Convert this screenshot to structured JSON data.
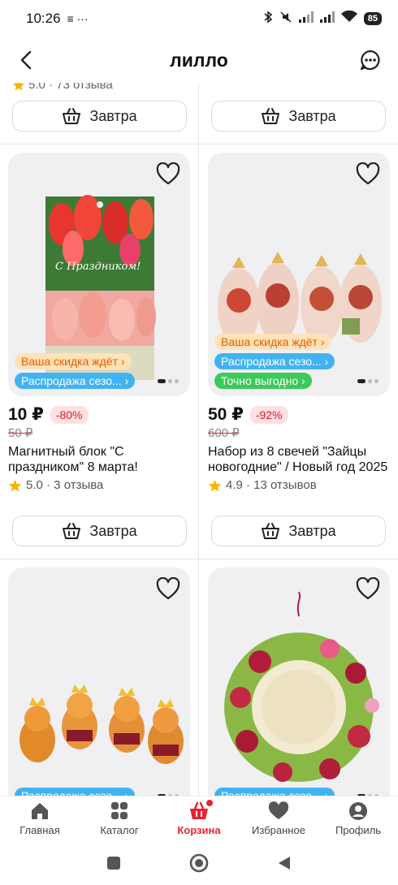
{
  "status": {
    "time": "10:26",
    "battery": "85"
  },
  "header": {
    "title": "лилло"
  },
  "partial_top": {
    "rating": "5.0 · 73 отзыва",
    "cart_left": "Завтра",
    "cart_right": "Завтра"
  },
  "products": [
    {
      "price": "10 ₽",
      "discount": "-80%",
      "old_price": "50 ₽",
      "title": "Магнитный блок \"С праздником\" 8 марта!",
      "rating": "5.0 · 3 отзыва",
      "badges": [
        "Ваша скидка ждёт ›",
        "Распродажа сезо... ›"
      ],
      "cart": "Завтра",
      "img_text": "С Праздником!"
    },
    {
      "price": "50 ₽",
      "discount": "-92%",
      "old_price": "600 ₽",
      "title": "Набор из 8 свечей \"Зайцы новогодние\" / Новый год 2025",
      "rating": "4.9 · 13 отзывов",
      "badges": [
        "Ваша скидка ждёт ›",
        "Распродажа сезо... ›",
        "Точно выгодно ›"
      ],
      "cart": "Завтра"
    },
    {
      "badges": [
        "Распродажа сезо... ›"
      ]
    },
    {
      "badges": [
        "Распродажа сезо... ›"
      ]
    }
  ],
  "nav": {
    "home": "Главная",
    "catalog": "Каталог",
    "cart": "Корзина",
    "favorites": "Избранное",
    "profile": "Профиль"
  },
  "colors": {
    "accent": "#e8222f",
    "sale_badge": "#41b3f2",
    "good_badge": "#3cc85a",
    "discount_badge_bg": "#ffe2b8"
  },
  "icons": [
    "back-arrow-icon",
    "chat-icon",
    "heart-icon",
    "cart-basket-icon",
    "star-icon",
    "home-icon",
    "catalog-grid-icon",
    "cart-icon",
    "favorites-heart-icon",
    "profile-icon"
  ]
}
